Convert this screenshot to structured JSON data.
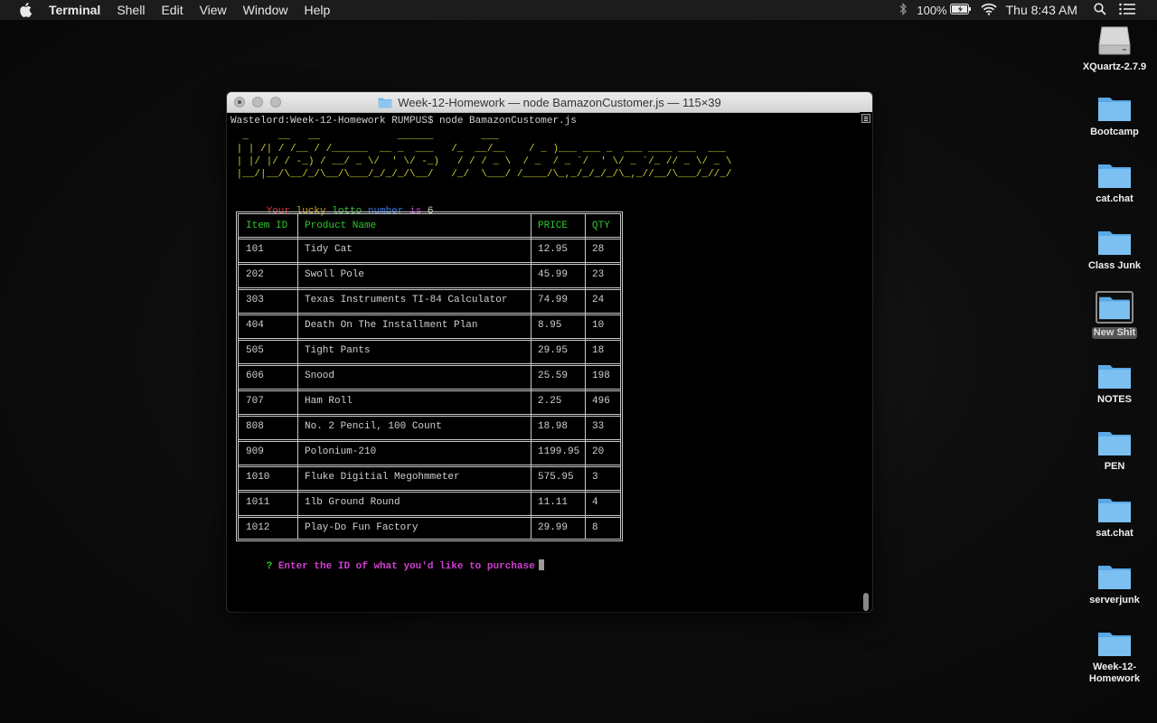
{
  "menubar": {
    "app": "Terminal",
    "items": [
      "Shell",
      "Edit",
      "View",
      "Window",
      "Help"
    ],
    "battery": "100%",
    "clock": "Thu 8:43 AM"
  },
  "desktop": {
    "icons": [
      {
        "label": "XQuartz-2.7.9",
        "kind": "drive"
      },
      {
        "label": "Bootcamp",
        "kind": "folder"
      },
      {
        "label": "cat.chat",
        "kind": "folder"
      },
      {
        "label": "Class Junk",
        "kind": "folder"
      },
      {
        "label": "New Shit",
        "kind": "folder",
        "selected": true
      },
      {
        "label": "NOTES",
        "kind": "folder"
      },
      {
        "label": "PEN",
        "kind": "folder"
      },
      {
        "label": "sat.chat",
        "kind": "folder"
      },
      {
        "label": "serverjunk",
        "kind": "folder"
      },
      {
        "label": "Week-12-Homework",
        "kind": "folder"
      }
    ]
  },
  "window": {
    "title": "Week-12-Homework — node BamazonCustomer.js — 115×39"
  },
  "terminal": {
    "prompt": "Wastelord:Week-12-Homework RUMPUS$ node BamazonCustomer.js",
    "ascii_art": [
      "  _     __   __             ______        ___",
      " | | /| / /__ / /______  __ _  ___   /_  __/__    / _ )___ ___ _  ___ ____ ___  ___",
      " | |/ |/ / -_) / __/ _ \\/  ' \\/ -_)   / / / _ \\  / _  / _ `/  ' \\/ _ `/_ // _ \\/ _ \\",
      " |__/|__/\\__/_/\\__/\\___/_/_/_/\\__/   /_/  \\___/ /____/\\_,_/_/_/_/\\_,_//__/\\___/_//_/"
    ],
    "lotto": {
      "words": [
        "Your",
        "lucky",
        "lotto",
        "number",
        "is"
      ],
      "colors": [
        "#e03a3a",
        "#d4a020",
        "#3ac43a",
        "#3a7ae0",
        "#c040d0"
      ],
      "number": "6"
    },
    "table": {
      "headers": [
        "Item ID",
        "Product Name",
        "PRICE",
        "QTY"
      ],
      "rows": [
        [
          "101",
          "Tidy Cat",
          "12.95",
          "28"
        ],
        [
          "202",
          "Swoll Pole",
          "45.99",
          "23"
        ],
        [
          "303",
          "Texas Instruments TI-84 Calculator",
          "74.99",
          "24"
        ],
        [
          "404",
          "Death On The Installment Plan",
          "8.95",
          "10"
        ],
        [
          "505",
          "Tight Pants",
          "29.95",
          "18"
        ],
        [
          "606",
          "Snood",
          "25.59",
          "198"
        ],
        [
          "707",
          "Ham Roll",
          "2.25",
          "496"
        ],
        [
          "808",
          "No. 2 Pencil, 100 Count",
          "18.98",
          "33"
        ],
        [
          "909",
          "Polonium-210",
          "1199.95",
          "20"
        ],
        [
          "1010",
          "Fluke Digitial Megohmmeter",
          "575.95",
          "3"
        ],
        [
          "1011",
          "1lb Ground Round",
          "11.11",
          "4"
        ],
        [
          "1012",
          "Play-Do Fun Factory",
          "29.99",
          "8"
        ]
      ]
    },
    "question_mark": "?",
    "question": "Enter the ID of what you'd like to purchase",
    "colors": {
      "ascii": "#cccc33",
      "header": "#2ec72e",
      "question_mark": "#2ec72e",
      "question": "#d040d0"
    }
  }
}
